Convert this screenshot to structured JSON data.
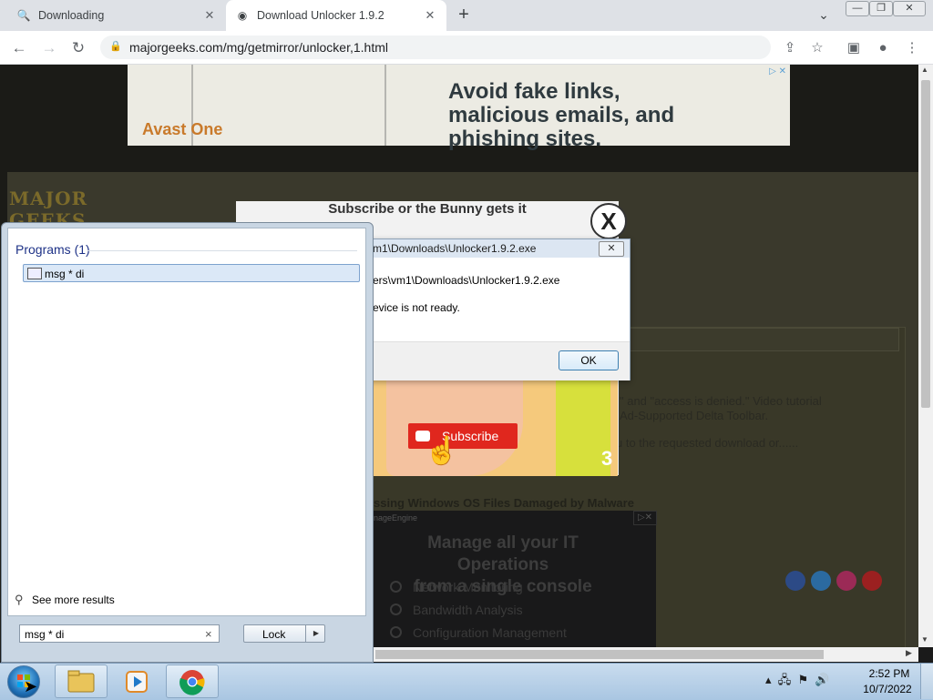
{
  "browser": {
    "tabs": [
      {
        "title": "Downloading",
        "favicon": "search-favicon"
      },
      {
        "title": "Download Unlocker 1.9.2",
        "favicon": "majorgeeks-favicon"
      }
    ],
    "url": "majorgeeks.com/mg/getmirror/unlocker,1.html"
  },
  "page": {
    "ad_headline": "Avoid fake links, malicious emails, and phishing sites.",
    "ad_brand": "Avast One",
    "logo_text": "MAJOR GEEKS",
    "article_snippet_1": "\" and \"access is denied.\" Video tutorial",
    "article_snippet_2": "Ad-Supported Delta Toolbar.",
    "article_more": "u to the requested download or......",
    "malware_title": "ssing Windows OS Files Damaged by Malware",
    "it_ad": {
      "vendor": "nageEngine",
      "headline_1": "Manage all your IT Operations",
      "headline_2": "from a single console",
      "options": [
        "Network Monitoring",
        "Bandwidth Analysis",
        "Configuration Management"
      ]
    }
  },
  "popup": {
    "title": "Subscribe or the Bunny gets it",
    "close_label": "X",
    "subscribe_label": "Subscribe",
    "counter": "3"
  },
  "error_dialog": {
    "title": "m1\\Downloads\\Unlocker1.9.2.exe",
    "path": "ers\\vm1\\Downloads\\Unlocker1.9.2.exe",
    "message": "evice is not ready.",
    "ok_label": "OK"
  },
  "start_menu": {
    "programs_header": "Programs (1)",
    "program_item": "msg * di",
    "see_more": "See more results",
    "search_value": "msg * di",
    "lock_label": "Lock"
  },
  "taskbar": {
    "time": "2:52 PM",
    "date": "10/7/2022"
  }
}
